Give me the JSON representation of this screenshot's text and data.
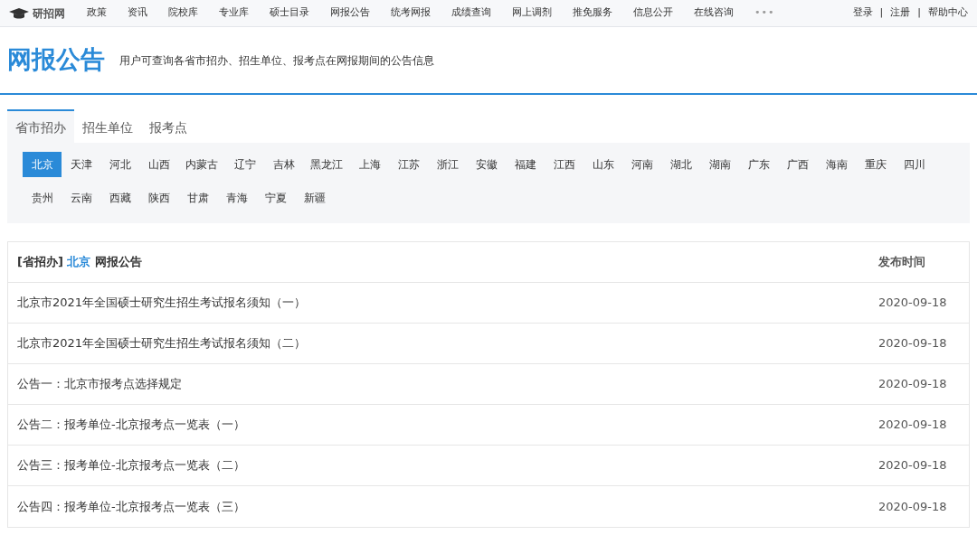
{
  "topnav": {
    "logo": "研招网",
    "items": [
      "政策",
      "资讯",
      "院校库",
      "专业库",
      "硕士目录",
      "网报公告",
      "统考网报",
      "成绩查询",
      "网上调剂",
      "推免服务",
      "信息公开",
      "在线咨询"
    ],
    "more": "•••",
    "account": [
      "登录",
      "注册",
      "帮助中心"
    ],
    "separator": "|"
  },
  "header": {
    "title": "网报公告",
    "description": "用户可查询各省市招办、招生单位、报考点在网报期间的公告信息"
  },
  "tabs": [
    {
      "label": "省市招办",
      "selected": true
    },
    {
      "label": "招生单位",
      "selected": false
    },
    {
      "label": "报考点",
      "selected": false
    }
  ],
  "provinces": [
    {
      "label": "北京",
      "selected": true
    },
    {
      "label": "天津",
      "selected": false
    },
    {
      "label": "河北",
      "selected": false
    },
    {
      "label": "山西",
      "selected": false
    },
    {
      "label": "内蒙古",
      "selected": false
    },
    {
      "label": "辽宁",
      "selected": false
    },
    {
      "label": "吉林",
      "selected": false
    },
    {
      "label": "黑龙江",
      "selected": false
    },
    {
      "label": "上海",
      "selected": false
    },
    {
      "label": "江苏",
      "selected": false
    },
    {
      "label": "浙江",
      "selected": false
    },
    {
      "label": "安徽",
      "selected": false
    },
    {
      "label": "福建",
      "selected": false
    },
    {
      "label": "江西",
      "selected": false
    },
    {
      "label": "山东",
      "selected": false
    },
    {
      "label": "河南",
      "selected": false
    },
    {
      "label": "湖北",
      "selected": false
    },
    {
      "label": "湖南",
      "selected": false
    },
    {
      "label": "广东",
      "selected": false
    },
    {
      "label": "广西",
      "selected": false
    },
    {
      "label": "海南",
      "selected": false
    },
    {
      "label": "重庆",
      "selected": false
    },
    {
      "label": "四川",
      "selected": false
    },
    {
      "label": "贵州",
      "selected": false
    },
    {
      "label": "云南",
      "selected": false
    },
    {
      "label": "西藏",
      "selected": false
    },
    {
      "label": "陕西",
      "selected": false
    },
    {
      "label": "甘肃",
      "selected": false
    },
    {
      "label": "青海",
      "selected": false
    },
    {
      "label": "宁夏",
      "selected": false
    },
    {
      "label": "新疆",
      "selected": false
    }
  ],
  "table": {
    "heading": {
      "prefix": "[省招办]",
      "province": "北京",
      "suffix": "网报公告"
    },
    "date_column": "发布时间",
    "rows": [
      {
        "title": "北京市2021年全国硕士研究生招生考试报名须知（一）",
        "date": "2020-09-18"
      },
      {
        "title": "北京市2021年全国硕士研究生招生考试报名须知（二）",
        "date": "2020-09-18"
      },
      {
        "title": "公告一：北京市报考点选择规定",
        "date": "2020-09-18"
      },
      {
        "title": "公告二：报考单位-北京报考点一览表（一）",
        "date": "2020-09-18"
      },
      {
        "title": "公告三：报考单位-北京报考点一览表（二）",
        "date": "2020-09-18"
      },
      {
        "title": "公告四：报考单位-北京报考点一览表（三）",
        "date": "2020-09-18"
      }
    ]
  }
}
